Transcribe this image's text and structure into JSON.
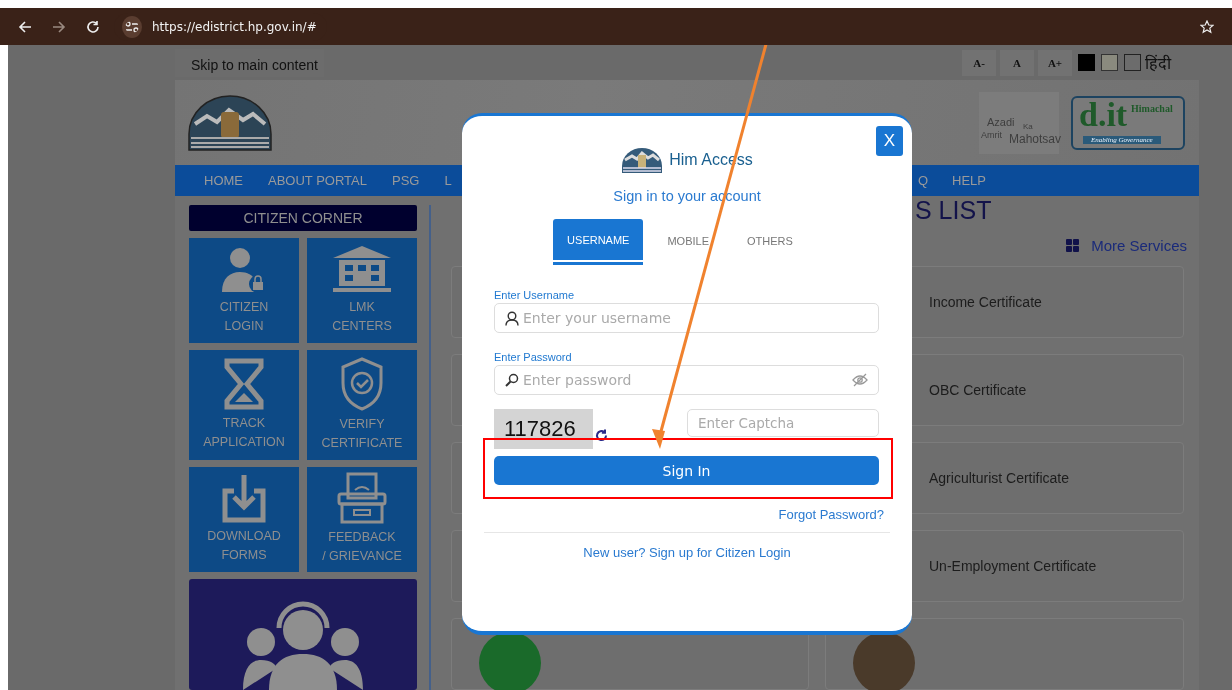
{
  "browser": {
    "url": "https://edistrict.hp.gov.in/#"
  },
  "top_links": {
    "skip_link": "Skip to main content",
    "text_size_buttons": [
      "A-",
      "A",
      "A+"
    ],
    "language": "हिंदी"
  },
  "header": {
    "azadi_logo": {
      "line_1": "Azadi",
      "line_2": "Ka",
      "line_3": "Amrit",
      "line_4": "Mahotsav"
    },
    "dit_logo": {
      "mark": "d.it",
      "name": "Himachal",
      "tagline": "Enabling Governance"
    }
  },
  "nav": {
    "left": [
      "HOME",
      "ABOUT PORTAL",
      "PSG",
      "L"
    ],
    "right": [
      "Q",
      "HELP"
    ]
  },
  "citizen_corner": {
    "title": "CITIZEN CORNER",
    "tiles": [
      {
        "kind": "user",
        "line_1": "CITIZEN",
        "line_2": "LOGIN"
      },
      {
        "kind": "building",
        "line_1": "LMK",
        "line_2": "CENTERS"
      },
      {
        "kind": "hourglass",
        "line_1": "TRACK",
        "line_2": "APPLICATION"
      },
      {
        "kind": "shield",
        "line_1": "VERIFY",
        "line_2": "CERTIFICATE"
      },
      {
        "kind": "download",
        "line_1": "DOWNLOAD",
        "line_2": "FORMS"
      },
      {
        "kind": "feedback",
        "line_1": "FEEDBACK",
        "line_2": "/ GRIEVANCE"
      }
    ]
  },
  "services": {
    "heading": "S LIST",
    "more_link": "More Services",
    "cards": [
      "Income Certificate",
      "OBC Certificate",
      "Agriculturist Certificate",
      "Un-Employment Certificate"
    ]
  },
  "login_modal": {
    "close": "X",
    "app_name": "Him Access",
    "subtitle": "Sign in to your account",
    "tabs": [
      {
        "label": "USERNAME",
        "selected": true
      },
      {
        "label": "MOBILE",
        "selected": false
      },
      {
        "label": "OTHERS",
        "selected": false
      }
    ],
    "username": {
      "label": "Enter Username",
      "placeholder": "Enter your username"
    },
    "password": {
      "label": "Enter Password",
      "placeholder": "Enter password"
    },
    "captcha": {
      "code": "117826",
      "placeholder": "Enter Captcha"
    },
    "sign_in": "Sign In",
    "forgot": "Forgot Password?",
    "signup": "New user? Sign up for Citizen Login"
  }
}
